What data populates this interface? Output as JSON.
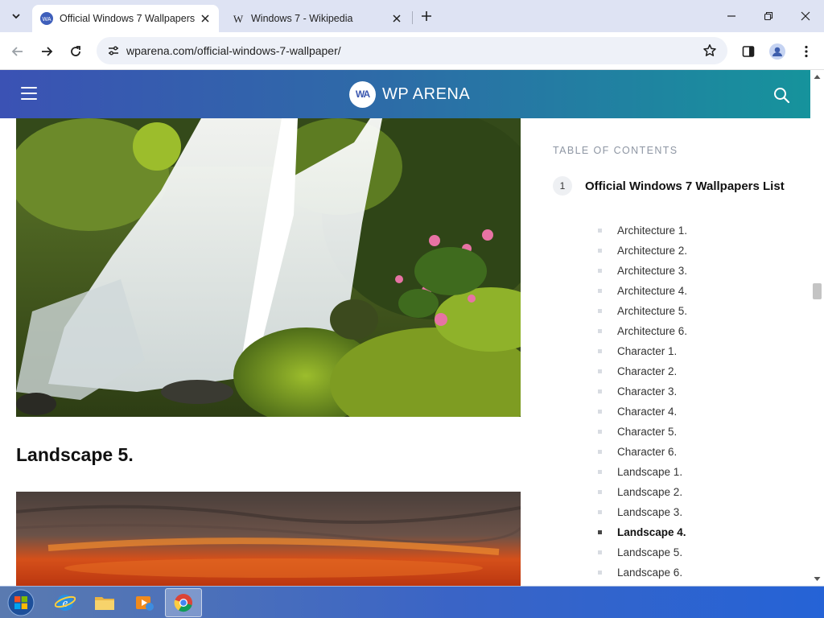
{
  "browser": {
    "tabs": [
      {
        "title": "Official Windows 7 Wallpapers",
        "favicon": "wp-arena-favicon-icon",
        "active": true
      },
      {
        "title": "Windows 7 - Wikipedia",
        "favicon": "wikipedia-favicon-icon",
        "active": false
      }
    ],
    "url": "wparena.com/official-windows-7-wallpaper/"
  },
  "site": {
    "logo_mark": "WA",
    "logo_text": "WP ARENA",
    "header_colors": [
      "#3b52b4",
      "#16939c"
    ]
  },
  "article": {
    "section_heading": "Landscape 5."
  },
  "toc": {
    "title": "TABLE OF CONTENTS",
    "number": "1",
    "heading": "Official Windows 7 Wallpapers List",
    "items": [
      "Architecture 1.",
      "Architecture 2.",
      "Architecture 3.",
      "Architecture 4.",
      "Architecture 5.",
      "Architecture 6.",
      "Character 1.",
      "Character 2.",
      "Character 3.",
      "Character 4.",
      "Character 5.",
      "Character 6.",
      "Landscape 1.",
      "Landscape 2.",
      "Landscape 3.",
      "Landscape 4.",
      "Landscape 5.",
      "Landscape 6."
    ],
    "current_item": "Landscape 4."
  },
  "taskbar": {
    "items": [
      "start-orb-icon",
      "internet-explorer-icon",
      "file-explorer-icon",
      "media-player-icon",
      "chrome-icon"
    ],
    "active_item": "chrome-icon"
  }
}
